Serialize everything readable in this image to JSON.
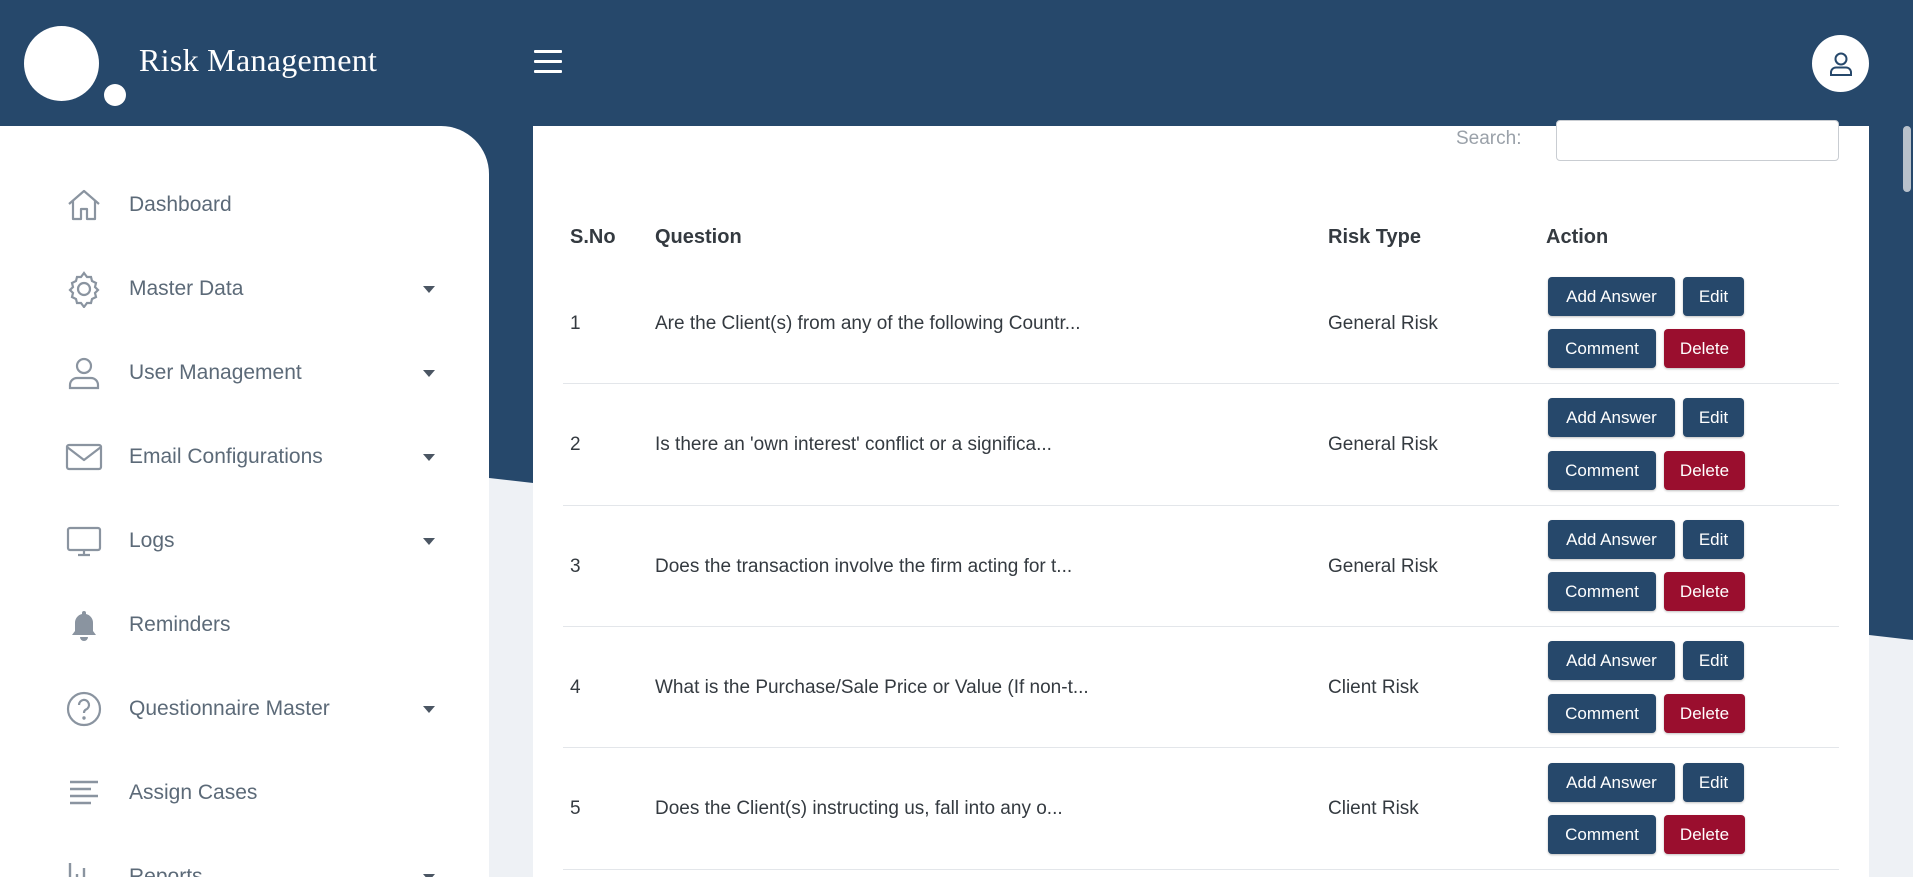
{
  "header": {
    "app_title": "Risk Management",
    "menu_icon": "hamburger-icon",
    "user_icon": "user-icon"
  },
  "colors": {
    "primary": "#26486b",
    "danger": "#9a0e2e",
    "sidebar_text": "#5c6a78"
  },
  "sidebar": {
    "items": [
      {
        "label": "Dashboard",
        "icon": "home-icon",
        "has_dropdown": false
      },
      {
        "label": "Master Data",
        "icon": "gear-icon",
        "has_dropdown": true
      },
      {
        "label": "User Management",
        "icon": "user-icon",
        "has_dropdown": true
      },
      {
        "label": "Email Configurations",
        "icon": "envelope-icon",
        "has_dropdown": true
      },
      {
        "label": "Logs",
        "icon": "monitor-icon",
        "has_dropdown": true
      },
      {
        "label": "Reminders",
        "icon": "bell-icon",
        "has_dropdown": false
      },
      {
        "label": "Questionnaire Master",
        "icon": "question-circle-icon",
        "has_dropdown": true
      },
      {
        "label": "Assign Cases",
        "icon": "align-left-icon",
        "has_dropdown": false
      },
      {
        "label": "Reports",
        "icon": "bar-chart-icon",
        "has_dropdown": true
      }
    ]
  },
  "search": {
    "label": "Search:",
    "value": ""
  },
  "table": {
    "headers": [
      "S.No",
      "Question",
      "Risk Type",
      "Action"
    ],
    "rows": [
      {
        "sno": "1",
        "question": "Are the Client(s) from any of the following Countr...",
        "risk_type": "General Risk"
      },
      {
        "sno": "2",
        "question": "Is there an 'own interest' conflict or a significa...",
        "risk_type": "General Risk"
      },
      {
        "sno": "3",
        "question": "Does the transaction involve the firm acting for t...",
        "risk_type": "General Risk"
      },
      {
        "sno": "4",
        "question": "What is the Purchase/Sale Price or Value (If non-t...",
        "risk_type": "Client Risk"
      },
      {
        "sno": "5",
        "question": "Does the Client(s) instructing us, fall into any o...",
        "risk_type": "Client Risk"
      }
    ],
    "actions": {
      "add_answer": "Add Answer",
      "edit": "Edit",
      "comment": "Comment",
      "delete": "Delete"
    }
  }
}
